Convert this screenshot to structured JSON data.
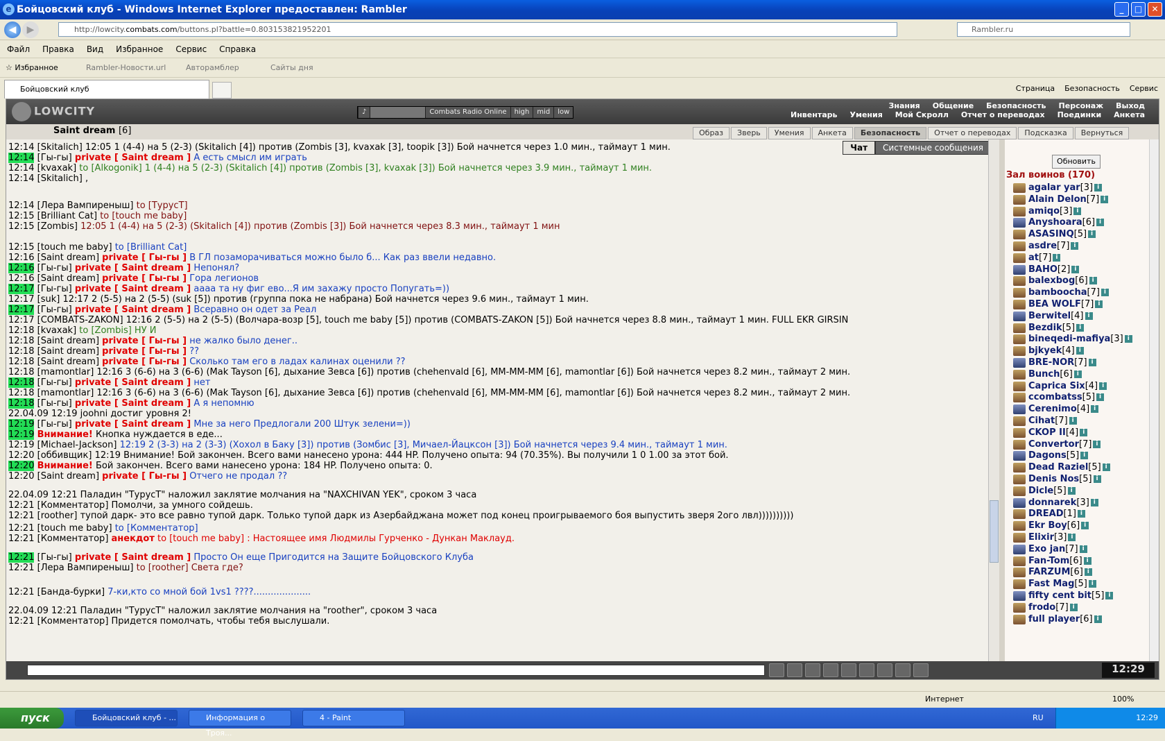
{
  "window": {
    "title": "Бойцовский клуб - Windows Internet Explorer предоставлен: Rambler"
  },
  "address": {
    "url_prefix": "http://lowcity.",
    "url_host": "combats.com",
    "url_path": "/buttons.pl?battle=0.803153821952201",
    "search_placeholder": "Rambler.ru"
  },
  "menu": [
    "Файл",
    "Правка",
    "Вид",
    "Избранное",
    "Сервис",
    "Справка"
  ],
  "favorites": {
    "label": "Избранное",
    "links": [
      "Rambler-Новости.url",
      "Авторамблер",
      "Сайты дня"
    ]
  },
  "tab": {
    "title": "Бойцовский клуб"
  },
  "commands": [
    "Страница",
    "Безопасность",
    "Сервис"
  ],
  "game": {
    "logo": "LOWCITY",
    "radio": [
      "Combats Radio Online",
      "high",
      "mid",
      "low"
    ],
    "links_row1": [
      "Знания",
      "Общение",
      "Безопасность",
      "Персонаж",
      "Выход"
    ],
    "links_row2": [
      "Инвентарь",
      "Умения",
      "Мой Скролл",
      "Отчет о переводах",
      "Поединки",
      "Анкета"
    ],
    "char_name": "Saint dream",
    "char_level": "[6]",
    "char_buttons": [
      "Образ",
      "Зверь",
      "Умения",
      "Анкета",
      "Безопасность",
      "Отчет о переводах",
      "Подсказка",
      "Вернуться"
    ]
  },
  "chat": {
    "tabs": [
      "Чат",
      "Системные сообщения"
    ],
    "lines": [
      {
        "time": "12:14",
        "hl": false,
        "nick": "Skitalich",
        "pv": "",
        "text": "12:05 1 (4-4) на 5 (2-3) (Skitalich [4]) против (Zombis [3], kvaxak [3], toopik [3]) Бой начнется через 1.0 мин., таймаут 1 мин.",
        "c": "t"
      },
      {
        "time": "12:14",
        "hl": true,
        "nick": "Гы-гы",
        "pv": "private [ Saint dream ]",
        "text": "А есть смысл им играть",
        "c": "blue"
      },
      {
        "time": "12:14",
        "hl": false,
        "nick": "kvaxak",
        "pv": "",
        "text": "to [Alkogonik] 1 (4-4) на 5 (2-3) (Skitalich [4]) против (Zombis [3], kvaxak [3]) Бой начнется через 3.9 мин., таймаут 1 мин.",
        "c": "green"
      },
      {
        "time": "12:14",
        "hl": false,
        "nick": "Skitalich",
        "pv": "",
        "text": ",",
        "c": "t"
      },
      {
        "time": "12:14",
        "hl": false,
        "nick": "Лера Вампиреныш",
        "pv": "",
        "text": "to [ТурусТ]",
        "c": "dred"
      },
      {
        "time": "12:15",
        "hl": false,
        "nick": "Brilliant Cat",
        "pv": "",
        "text": "to [touch me baby]",
        "c": "dred"
      },
      {
        "time": "12:15",
        "hl": false,
        "nick": "Zombis",
        "pv": "",
        "text": "12:05 1 (4-4) на 5 (2-3) (Skitalich [4]) против (Zombis [3]) Бой начнется через 8.3 мин., таймаут 1 мин",
        "c": "dred"
      },
      {
        "time": "12:15",
        "hl": false,
        "nick": "touch me baby",
        "pv": "",
        "text": "to [Brilliant Cat]",
        "c": "blue"
      },
      {
        "time": "12:16",
        "hl": false,
        "nick": "Saint dream",
        "pv": "private [ Гы-гы ]",
        "text": "В ГЛ позаморачиваться можно было б... Как раз ввели недавно.",
        "c": "blue"
      },
      {
        "time": "12:16",
        "hl": true,
        "nick": "Гы-гы",
        "pv": "private [ Saint dream ]",
        "text": "Непонял?",
        "c": "blue"
      },
      {
        "time": "12:16",
        "hl": false,
        "nick": "Saint dream",
        "pv": "private [ Гы-гы ]",
        "text": "Гора легионов",
        "c": "blue"
      },
      {
        "time": "12:17",
        "hl": true,
        "nick": "Гы-гы",
        "pv": "private [ Saint dream ]",
        "text": "аааа та ну фиг ево...Я им захажу просто Попугать=))",
        "c": "blue"
      },
      {
        "time": "12:17",
        "hl": false,
        "nick": "suk",
        "pv": "",
        "text": "12:17 2 (5-5) на 2 (5-5) (suk [5]) против (группа пока не набрана) Бой начнется через 9.6 мин., таймаут 1 мин.",
        "c": "t"
      },
      {
        "time": "12:17",
        "hl": true,
        "nick": "Гы-гы",
        "pv": "private [ Saint dream ]",
        "text": "Всеравно он одет за Реал",
        "c": "blue"
      },
      {
        "time": "12:17",
        "hl": false,
        "nick": "COMBATS-ZAKON",
        "pv": "",
        "text": "12:16 2 (5-5) на 2 (5-5) (Волчара-возр [5], touch me baby [5]) против (COMBATS-ZAKON [5]) Бой начнется через 8.8 мин., таймаут 1 мин. FULL EKR GIRSIN",
        "c": "t"
      },
      {
        "time": "12:18",
        "hl": false,
        "nick": "kvaxak",
        "pv": "",
        "text": "to [Zombis] НУ И",
        "c": "green"
      },
      {
        "time": "12:18",
        "hl": false,
        "nick": "Saint dream",
        "pv": "private [ Гы-гы ]",
        "text": "не жалко было денег..",
        "c": "blue"
      },
      {
        "time": "12:18",
        "hl": false,
        "nick": "Saint dream",
        "pv": "private [ Гы-гы ]",
        "text": "??",
        "c": "blue"
      },
      {
        "time": "12:18",
        "hl": false,
        "nick": "Saint dream",
        "pv": "private [ Гы-гы ]",
        "text": "Сколько там его в ладах калинах оценили ??",
        "c": "blue"
      },
      {
        "time": "12:18",
        "hl": false,
        "nick": "mamontlar",
        "pv": "",
        "text": "12:16 3 (6-6) на 3 (6-6) (Mak Tayson [6], дыхание Зевса [6]) против (chehenvald [6], MM-MM-MM [6], mamontlar [6]) Бой начнется через 8.2 мин., таймаут 2 мин.",
        "c": "t"
      },
      {
        "time": "12:18",
        "hl": true,
        "nick": "Гы-гы",
        "pv": "private [ Saint dream ]",
        "text": "нет",
        "c": "blue"
      },
      {
        "time": "12:18",
        "hl": false,
        "nick": "mamontlar",
        "pv": "",
        "text": "12:16 3 (6-6) на 3 (6-6) (Mak Tayson [6], дыхание Зевса [6]) против (chehenvald [6], MM-MM-MM [6], mamontlar [6]) Бой начнется через 8.2 мин., таймаут 2 мин.",
        "c": "t"
      },
      {
        "time": "12:18",
        "hl": true,
        "nick": "Гы-гы",
        "pv": "private [ Saint dream ]",
        "text": "А я непомню",
        "c": "blue"
      },
      {
        "time": "22.04.09 12:19",
        "hl": false,
        "nick": "",
        "pv": "",
        "text": "joohni достиг уровня 2!",
        "c": "t"
      },
      {
        "time": "12:19",
        "hl": true,
        "nick": "Гы-гы",
        "pv": "private [ Saint dream ]",
        "text": "Мне за него Предлогали 200 Штук зелени=))",
        "c": "blue"
      },
      {
        "time": "12:19",
        "hl": true,
        "nick": "",
        "pv": "Внимание!",
        "text": "Кнопка нуждается в еде...",
        "c": "t"
      },
      {
        "time": "12:19",
        "hl": false,
        "nick": "Michael-Jackson",
        "pv": "",
        "text": "12:19 2 (3-3) на 2 (3-3) (Хохол в Баку [3]) против (Зомбис [3], Мичаел-Йацксон [3]) Бой начнется через 9.4 мин., таймаут 1 мин.",
        "c": "blue"
      },
      {
        "time": "12:20",
        "hl": false,
        "nick": "оббивщик",
        "pv": "",
        "text": "12:19 Внимание! Бой закончен. Всего вами нанесено урона: 444 HP. Получено опыта: 94 (70.35%). Вы получили 1 0 1.00 за этот бой.",
        "c": "t"
      },
      {
        "time": "12:20",
        "hl": true,
        "nick": "",
        "pv": "Внимание!",
        "text": "Бой закончен. Всего вами нанесено урона: 184 HP. Получено опыта: 0.",
        "c": "t"
      },
      {
        "time": "12:20",
        "hl": false,
        "nick": "Saint dream",
        "pv": "private [ Гы-гы ]",
        "text": "Отчего не продал ??",
        "c": "blue"
      },
      {
        "time": "22.04.09 12:21",
        "hl": false,
        "nick": "",
        "pv": "",
        "text": "Паладин \"ТурусТ\" наложил заклятие молчания на \"NAXCHIVAN YEK\", сроком 3 часа",
        "c": "t"
      },
      {
        "time": "12:21",
        "hl": false,
        "nick": "Комментатор",
        "pv": "",
        "text": "Помолчи, за умного сойдешь.",
        "c": "t"
      },
      {
        "time": "12:21",
        "hl": false,
        "nick": "roother",
        "pv": "",
        "text": "тупой дарк- это все равно тупой дарк. Только тупой дарк из Азербайджана может под конец проигрываемого боя выпустить зверя 2ого лвл))))))))))",
        "c": "t"
      },
      {
        "time": "12:21",
        "hl": false,
        "nick": "touch me baby",
        "pv": "",
        "text": "to [Комментатор]",
        "c": "blue"
      },
      {
        "time": "12:21",
        "hl": false,
        "nick": "Комментатор",
        "pv": "анекдот",
        "text": "to [touch me baby] : Настоящее имя Людмилы Гурченко - Дункан Маклауд.",
        "c": "red"
      },
      {
        "time": "12:21",
        "hl": true,
        "nick": "Гы-гы",
        "pv": "private [ Saint dream ]",
        "text": "Просто Он еще Пригодится на Защите Бойцовского Клуба",
        "c": "blue"
      },
      {
        "time": "12:21",
        "hl": false,
        "nick": "Лера Вампиреныш",
        "pv": "",
        "text": "to [roother] Света где?",
        "c": "dred"
      },
      {
        "time": "12:21",
        "hl": false,
        "nick": "Банда-бурки",
        "pv": "",
        "text": "7-ки,кто со мной бой 1vs1 ????....................",
        "c": "blue"
      },
      {
        "time": "22.04.09 12:21",
        "hl": false,
        "nick": "",
        "pv": "",
        "text": "Паладин \"ТурусТ\" наложил заклятие молчания на \"roother\", сроком 3 часа",
        "c": "t"
      },
      {
        "time": "12:21",
        "hl": false,
        "nick": "Комментатор",
        "pv": "",
        "text": "Придется помолчать, чтобы тебя выслушали.",
        "c": "t"
      }
    ]
  },
  "sidebar": {
    "refresh": "Обновить",
    "hall": "Зал воинов (170)",
    "users": [
      {
        "n": "agalar yar",
        "l": "[3]"
      },
      {
        "n": "Alain Delon",
        "l": "[7]"
      },
      {
        "n": "amiqo",
        "l": "[3]"
      },
      {
        "n": "Anyshoara",
        "l": "[6]"
      },
      {
        "n": "ASASINQ",
        "l": "[5]"
      },
      {
        "n": "asdre",
        "l": "[7]"
      },
      {
        "n": "at",
        "l": "[7]"
      },
      {
        "n": "BAHO",
        "l": "[2]"
      },
      {
        "n": "balexbog",
        "l": "[6]"
      },
      {
        "n": "bamboocha",
        "l": "[7]"
      },
      {
        "n": "BEA WOLF",
        "l": "[7]"
      },
      {
        "n": "Berwitel",
        "l": "[4]"
      },
      {
        "n": "Bezdik",
        "l": "[5]"
      },
      {
        "n": "bineqedi-mafiya",
        "l": "[3]"
      },
      {
        "n": "bjkyek",
        "l": "[4]"
      },
      {
        "n": "BRE-NOR",
        "l": "[7]"
      },
      {
        "n": "Bunch",
        "l": "[6]"
      },
      {
        "n": "Caprica Six",
        "l": "[4]"
      },
      {
        "n": "ccombatss",
        "l": "[5]"
      },
      {
        "n": "Cerenimo",
        "l": "[4]"
      },
      {
        "n": "Cihat",
        "l": "[7]"
      },
      {
        "n": "CKOP II",
        "l": "[4]"
      },
      {
        "n": "Convertor",
        "l": "[7]"
      },
      {
        "n": "Dagons",
        "l": "[5]"
      },
      {
        "n": "Dead Raziel",
        "l": "[5]"
      },
      {
        "n": "Denis Nos",
        "l": "[5]"
      },
      {
        "n": "Dicle",
        "l": "[5]"
      },
      {
        "n": "donnarek",
        "l": "[3]"
      },
      {
        "n": "DREAD",
        "l": "[1]"
      },
      {
        "n": "Ekr Boy",
        "l": "[6]"
      },
      {
        "n": "Elixir",
        "l": "[3]"
      },
      {
        "n": "Exo jan",
        "l": "[7]"
      },
      {
        "n": "Fan-Tom",
        "l": "[6]"
      },
      {
        "n": "FARZUM",
        "l": "[6]"
      },
      {
        "n": "Fast Mag",
        "l": "[5]"
      },
      {
        "n": "fifty cent bit",
        "l": "[5]"
      },
      {
        "n": "frodo",
        "l": "[7]"
      },
      {
        "n": "full player",
        "l": "[6]"
      }
    ]
  },
  "clock": "12:29",
  "status": {
    "zone": "Интернет",
    "zoom": "100%"
  },
  "taskbar": {
    "start": "пуск",
    "items": [
      "Бойцовский клуб - ...",
      "Информация о Троя...",
      "4 - Paint"
    ],
    "lang": "RU",
    "time": "12:29"
  }
}
